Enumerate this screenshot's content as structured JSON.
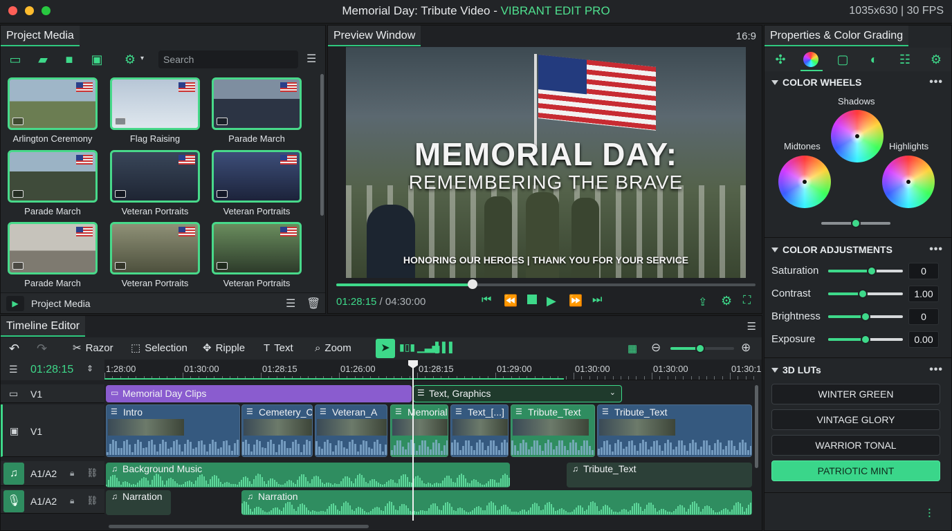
{
  "window": {
    "title_main": "Memorial Day: Tribute Video - ",
    "title_brand": "VIBRANT EDIT PRO",
    "resolution": "1035x630 | 30 FPS"
  },
  "colors": {
    "accent": "#3ed98a",
    "purple_clip": "#8a5ccf",
    "blue_clip": "#35597f",
    "audio_clip": "#2f8d60"
  },
  "media": {
    "tab": "Project Media",
    "search_placeholder": "Search",
    "footer_label": "Project Media",
    "items": [
      {
        "caption": "Arlington Ceremony"
      },
      {
        "caption": "Flag Raising"
      },
      {
        "caption": "Parade March"
      },
      {
        "caption": "Parade March"
      },
      {
        "caption": "Veteran Portraits"
      },
      {
        "caption": "Veteran Portraits"
      },
      {
        "caption": "Parade March"
      },
      {
        "caption": "Veteran Portraits"
      },
      {
        "caption": "Veteran Portraits"
      }
    ]
  },
  "preview": {
    "tab": "Preview Window",
    "aspect": "16:9",
    "headline": "MEMORIAL DAY:",
    "subhead": "REMEMBERING THE BRAVE",
    "caption": "HONORING OUR HEROES |  THANK YOU FOR YOUR SERVICE",
    "current_time": "01:28:15",
    "total_time": " / 04:30:00",
    "progress": 0.325
  },
  "properties": {
    "tab": "Properties & Color Grading",
    "color_wheels": {
      "title": "COLOR WHEELS",
      "shadows": "Shadows",
      "midtones": "Midtones",
      "highlights": "Highlights"
    },
    "adjustments": {
      "title": "COLOR ADJUSTMENTS",
      "rows": [
        {
          "label": "Saturation",
          "value": "0",
          "level": 0.58
        },
        {
          "label": "Contrast",
          "value": "1.00",
          "level": 0.46
        },
        {
          "label": "Brightness",
          "value": "0",
          "level": 0.5
        },
        {
          "label": "Exposure",
          "value": "0.00",
          "level": 0.5
        }
      ]
    },
    "luts": {
      "title": "3D LUTs",
      "items": [
        {
          "label": "WINTER GREEN",
          "active": false
        },
        {
          "label": "VINTAGE GLORY",
          "active": false
        },
        {
          "label": "WARRIOR TONAL",
          "active": false
        },
        {
          "label": "PATRIOTIC MINT",
          "active": true
        }
      ]
    }
  },
  "timeline": {
    "tab": "Timeline Editor",
    "timecode": "01:28:15",
    "tools": [
      "Razor",
      "Selection",
      "Ripple",
      "Text",
      "Zoom"
    ],
    "ruler": [
      "1:28:00",
      "01:30:00",
      "01:28:15",
      "01:26:00",
      "01:28:15",
      "01:29:00",
      "01:30:00",
      "01:30:00",
      "01:30:1"
    ],
    "tracks": [
      {
        "label": "V1"
      },
      {
        "label": "V1"
      },
      {
        "label": "A1/A2"
      },
      {
        "label": "A1/A2"
      }
    ],
    "group_clips": {
      "left": "Memorial Day Clips",
      "right": "Text, Graphics"
    },
    "video_clips": [
      "Intro",
      "Cemetery_C",
      "Veteran_A",
      "Memorial",
      "Text_[...]",
      "Tribute_Text",
      "Tribute_Text"
    ],
    "audio_clips": {
      "music": "Background Music",
      "music2": "Tribute_Text",
      "narration1": "Narration",
      "narration2": "Narration"
    }
  }
}
